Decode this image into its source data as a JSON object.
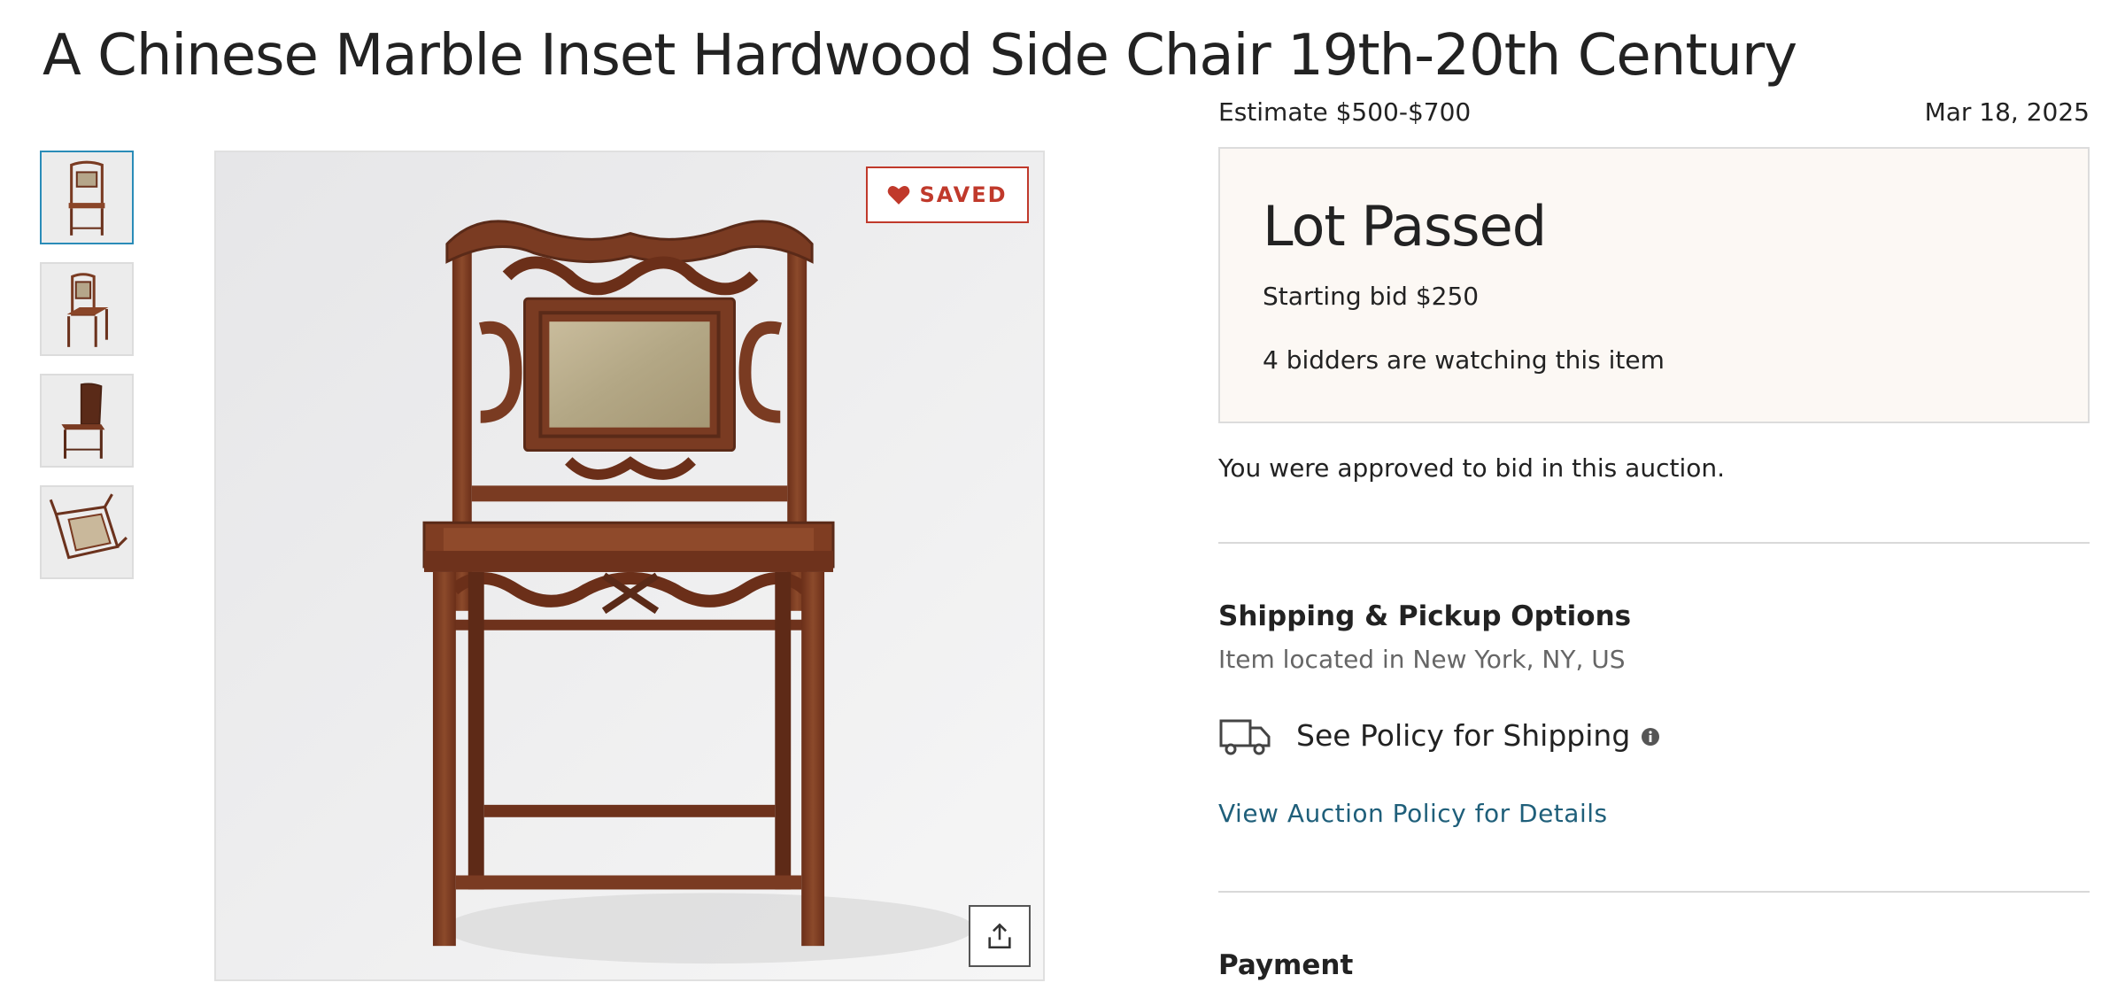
{
  "lot": {
    "title": "A Chinese Marble Inset Hardwood Side Chair 19th-20th Century"
  },
  "gallery": {
    "thumbnails": [
      {
        "name": "thumbnail-front-view",
        "selected": true
      },
      {
        "name": "thumbnail-angled-view",
        "selected": false
      },
      {
        "name": "thumbnail-side-view",
        "selected": false
      },
      {
        "name": "thumbnail-underside-view",
        "selected": false
      }
    ],
    "saved_label": "SAVED",
    "saved_icon": "heart-icon",
    "share_icon": "share-icon"
  },
  "auction": {
    "estimate": "Estimate $500-$700",
    "date": "Mar 18, 2025",
    "status": "Lot Passed",
    "starting_bid": "Starting bid $250",
    "watchers": "4 bidders are watching this item",
    "approval": "You were approved to bid in this auction."
  },
  "shipping": {
    "heading": "Shipping & Pickup Options",
    "location": "Item located in New York, NY, US",
    "policy_text": "See Policy for Shipping",
    "policy_icon": "truck-icon",
    "info_icon": "info-icon",
    "auction_policy_link": "View Auction Policy for Details"
  },
  "payment": {
    "heading": "Payment"
  },
  "colors": {
    "accent_red": "#c0392b",
    "link_blue": "#1f5f7a",
    "status_bg": "#fcf8f4",
    "selected_thumb": "#2a8cb8",
    "wood": "#7a3b22"
  }
}
